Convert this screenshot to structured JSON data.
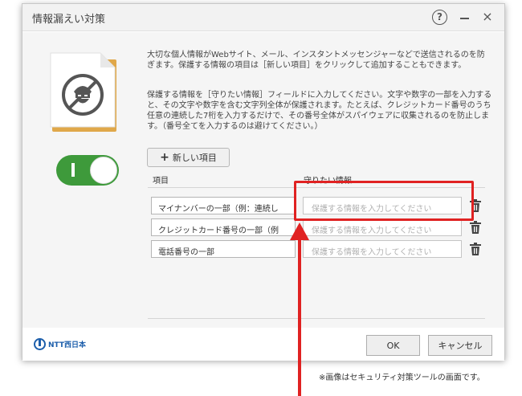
{
  "window": {
    "title": "情報漏えい対策",
    "help_icon": "?",
    "minimize_icon": "minimize-icon",
    "close_icon": "×"
  },
  "protection_toggle": {
    "state": "on",
    "mark": "I"
  },
  "description": {
    "paragraph1": "大切な個人情報がWebサイト、メール、インスタントメッセンジャーなどで送信されるのを防ぎます。保護する情報の項目は［新しい項目］をクリックして追加することもできます。",
    "paragraph2": "保護する情報を［守りたい情報］フィールドに入力してください。文字や数字の一部を入力すると、その文字や数字を含む文字列全体が保護されます。たとえば、クレジットカード番号のうち任意の連続した7桁を入力するだけで、その番号全体がスパイウェアに収集されるのを防止します。（番号全てを入力するのは避けてください。）"
  },
  "add_button": {
    "icon": "+",
    "label": "新しい項目"
  },
  "table": {
    "columns": [
      "項目",
      "守りたい情報"
    ],
    "rows": [
      {
        "item": "マイナンバーの一部（例：連続し",
        "info_placeholder": "保護する情報を入力してください"
      },
      {
        "item": "クレジットカード番号の一部（例",
        "info_placeholder": "保護する情報を入力してください"
      },
      {
        "item": "電話番号の一部",
        "info_placeholder": "保護する情報を入力してください"
      }
    ]
  },
  "footer": {
    "brand": "NTT西日本",
    "ok_label": "OK",
    "cancel_label": "キャンセル"
  },
  "annotation": {
    "note": "※画像はセキュリティ対策ツールの画面です。",
    "color": "#e02222"
  },
  "colors": {
    "toggle_on": "#3e9a3b",
    "brand": "#1c5eab"
  }
}
